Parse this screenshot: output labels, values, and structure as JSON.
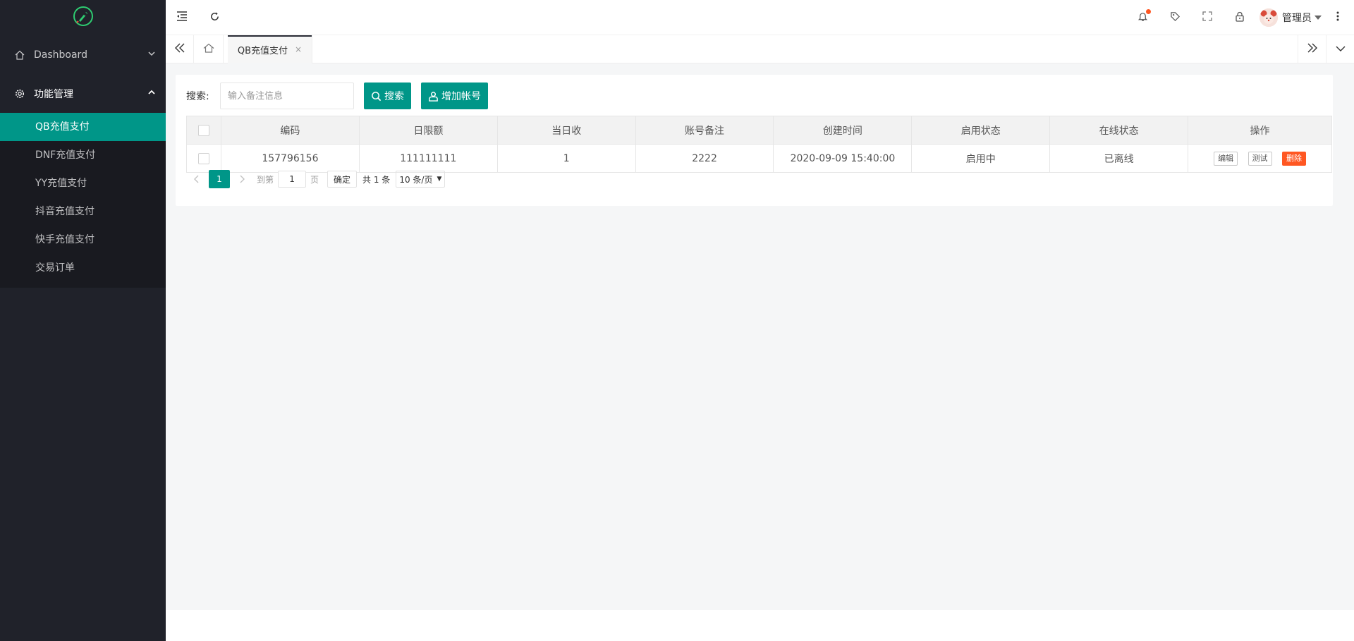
{
  "sidebar": {
    "menu": [
      {
        "label": "Dashboard",
        "icon": "home-icon",
        "open": false
      },
      {
        "label": "功能管理",
        "icon": "gear-icon",
        "open": true
      }
    ],
    "submenu": [
      {
        "label": "QB充值支付",
        "active": true
      },
      {
        "label": "DNF充值支付",
        "active": false
      },
      {
        "label": "YY充值支付",
        "active": false
      },
      {
        "label": "抖音充值支付",
        "active": false
      },
      {
        "label": "快手充值支付",
        "active": false
      },
      {
        "label": "交易订单",
        "active": false
      }
    ]
  },
  "header": {
    "user_name": "管理员"
  },
  "tabs": {
    "active_label": "QB充值支付",
    "close": "×"
  },
  "search": {
    "label": "搜索:",
    "placeholder": "输入备注信息",
    "value": "",
    "search_button": "搜索",
    "add_button": "增加帐号"
  },
  "table": {
    "headers": [
      "编码",
      "日限额",
      "当日收",
      "账号备注",
      "创建时间",
      "启用状态",
      "在线状态",
      "操作"
    ],
    "rows": [
      {
        "code": "157796156",
        "daily_limit": "111111111",
        "daily_received": "1",
        "remark": "2222",
        "created": "2020-09-09 15:40:00",
        "enabled": "启用中",
        "online": "已离线",
        "actions": {
          "edit": "编辑",
          "test": "测试",
          "delete": "删除"
        }
      }
    ]
  },
  "pager": {
    "current": "1",
    "goto_label": "到第",
    "goto_value": "1",
    "page_label": "页",
    "confirm": "确定",
    "total": "共 1 条",
    "page_size": "10 条/页"
  },
  "colors": {
    "accent": "#009688",
    "sidebar_bg": "#20222a",
    "danger": "#ff5722",
    "success": "#5fb878"
  }
}
